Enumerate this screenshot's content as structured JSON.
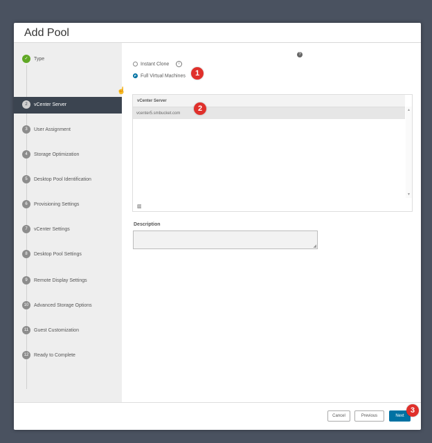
{
  "dialog": {
    "title": "Add Pool"
  },
  "steps": [
    {
      "num": "✓",
      "label": "Type",
      "state": "done"
    },
    {
      "num": "2",
      "label": "vCenter Server",
      "state": "active"
    },
    {
      "num": "3",
      "label": "User Assignment",
      "state": "pending"
    },
    {
      "num": "4",
      "label": "Storage Optimization",
      "state": "pending"
    },
    {
      "num": "5",
      "label": "Desktop Pool Identification",
      "state": "pending"
    },
    {
      "num": "6",
      "label": "Provisioning Settings",
      "state": "pending"
    },
    {
      "num": "7",
      "label": "vCenter Settings",
      "state": "pending"
    },
    {
      "num": "8",
      "label": "Desktop Pool Settings",
      "state": "pending"
    },
    {
      "num": "9",
      "label": "Remote Display Settings",
      "state": "pending"
    },
    {
      "num": "10",
      "label": "Advanced Storage Options",
      "state": "pending"
    },
    {
      "num": "11",
      "label": "Guest Customization",
      "state": "pending"
    },
    {
      "num": "12",
      "label": "Ready to Complete",
      "state": "pending"
    }
  ],
  "main": {
    "help_icon": "?",
    "radio_instant_clone": "Instant Clone",
    "info_icon": "i",
    "radio_full_vm": "Full Virtual Machines",
    "grid": {
      "column_header": "vCenter Server",
      "rows": [
        "vcenter5.smbucket.com"
      ],
      "scroll_up": "▲",
      "scroll_down": "▼",
      "column_toggle": "▥"
    },
    "description_label": "Description",
    "description_value": ""
  },
  "annotations": [
    "1",
    "2",
    "3"
  ],
  "footer": {
    "cancel": "Cancel",
    "previous": "Previous",
    "next": "Next"
  },
  "colors": {
    "accent": "#0072a3",
    "done": "#60a825",
    "sidebar_active": "#3b4450",
    "badge": "#e0302b"
  }
}
